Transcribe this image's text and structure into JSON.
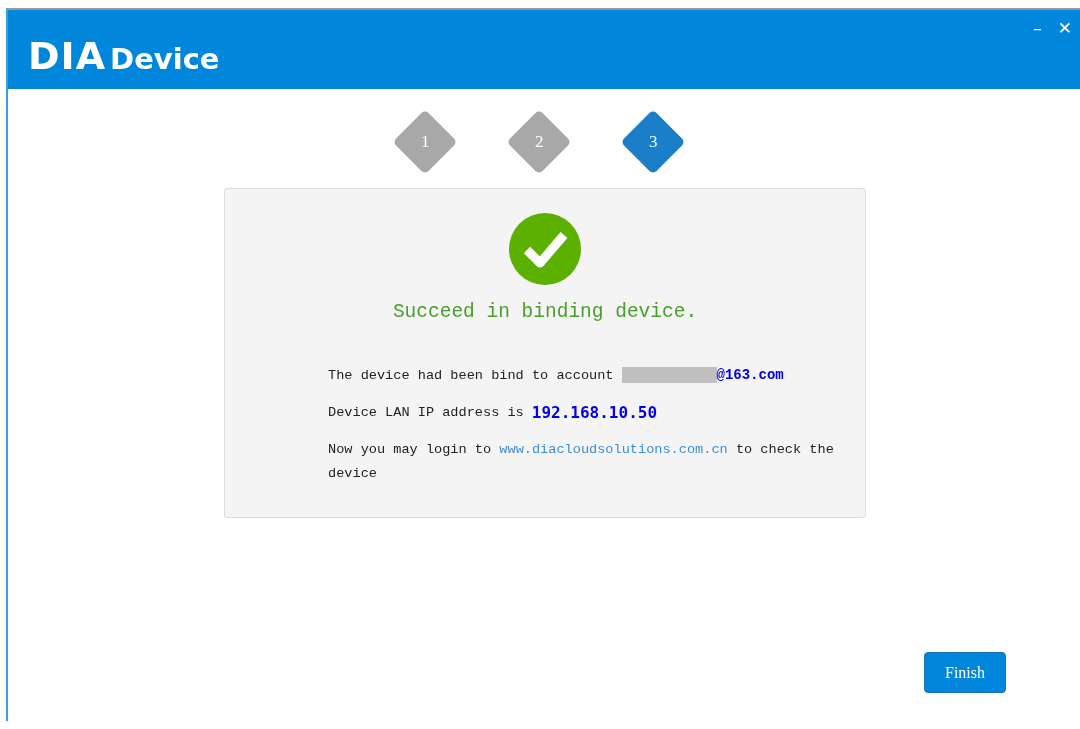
{
  "window": {
    "logo_bold": "DIA",
    "logo_rest": "Device",
    "controls": [
      "–",
      "✕"
    ]
  },
  "steps": [
    {
      "label": "1",
      "selected": false
    },
    {
      "label": "2",
      "selected": false
    },
    {
      "label": "3",
      "selected": true
    }
  ],
  "result": {
    "title": "Succeed in binding device.",
    "account_line": {
      "text": "The device had been bind to account",
      "account": "@163.com"
    },
    "ip_line": {
      "text": "Device LAN IP address is",
      "ip": "192.168.10.50"
    },
    "login_line": {
      "before": "Now you may login to",
      "link": "www.diacloudsolutions.com.cn",
      "after": "to check the device"
    }
  },
  "buttons": [
    "Finish"
  ]
}
